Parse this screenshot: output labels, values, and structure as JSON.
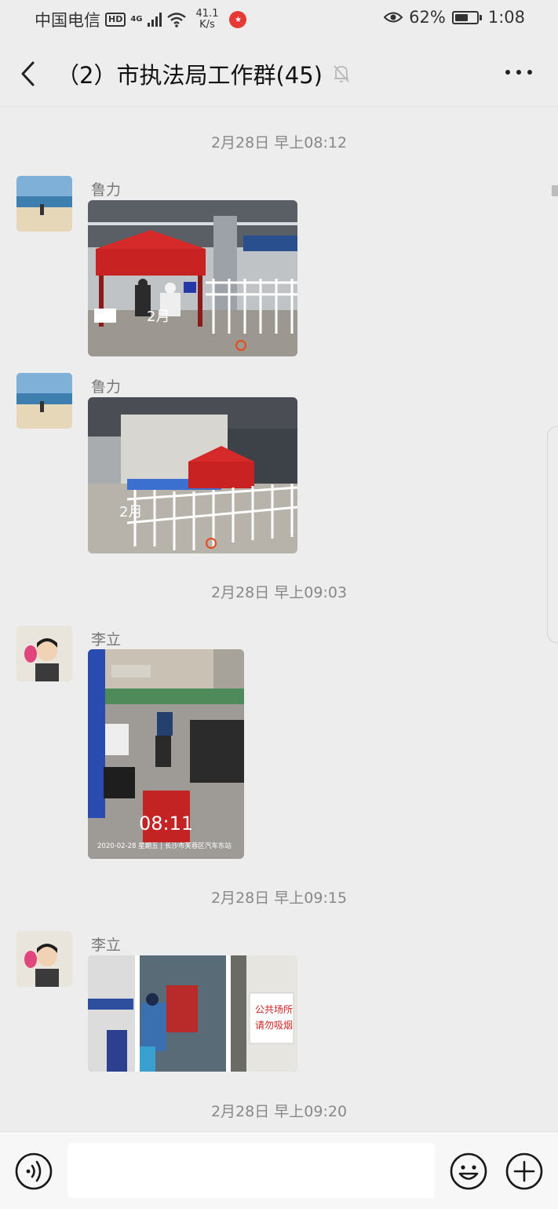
{
  "status_bar": {
    "carrier": "中国电信",
    "hd": "HD",
    "network": "4G",
    "speed_value": "41.1",
    "speed_unit": "K/s",
    "battery": "62%",
    "battery_level": 0.62,
    "time": "1:08"
  },
  "header": {
    "title": "（2）市执法局工作群(45)",
    "back_icon": "chevron-left-icon",
    "mute_icon": "bell-off-icon",
    "more_icon": "more-dots-icon"
  },
  "chat": {
    "timestamps": [
      "2月28日 早上08:12",
      "2月28日 早上09:03",
      "2月28日 早上09:15",
      "2月28日 早上09:20"
    ],
    "messages": [
      {
        "sender": "鲁力",
        "photo_caption": "2月"
      },
      {
        "sender": "鲁力",
        "photo_caption": "2月"
      },
      {
        "sender": "李立",
        "photo_time": "08:11",
        "photo_caption": "2020-02-28 星期五 | 长沙市芙蓉区汽车东站"
      },
      {
        "sender": "李立",
        "sign_line1": "公共场所",
        "sign_line2": "请勿吸烟"
      }
    ]
  },
  "input_bar": {
    "placeholder": "",
    "voice_icon": "voice-icon",
    "emoji_icon": "emoji-icon",
    "plus_icon": "plus-circle-icon"
  },
  "colors": {
    "background": "#ededed",
    "tent_red": "#d62a2a",
    "text_muted": "#888888"
  }
}
